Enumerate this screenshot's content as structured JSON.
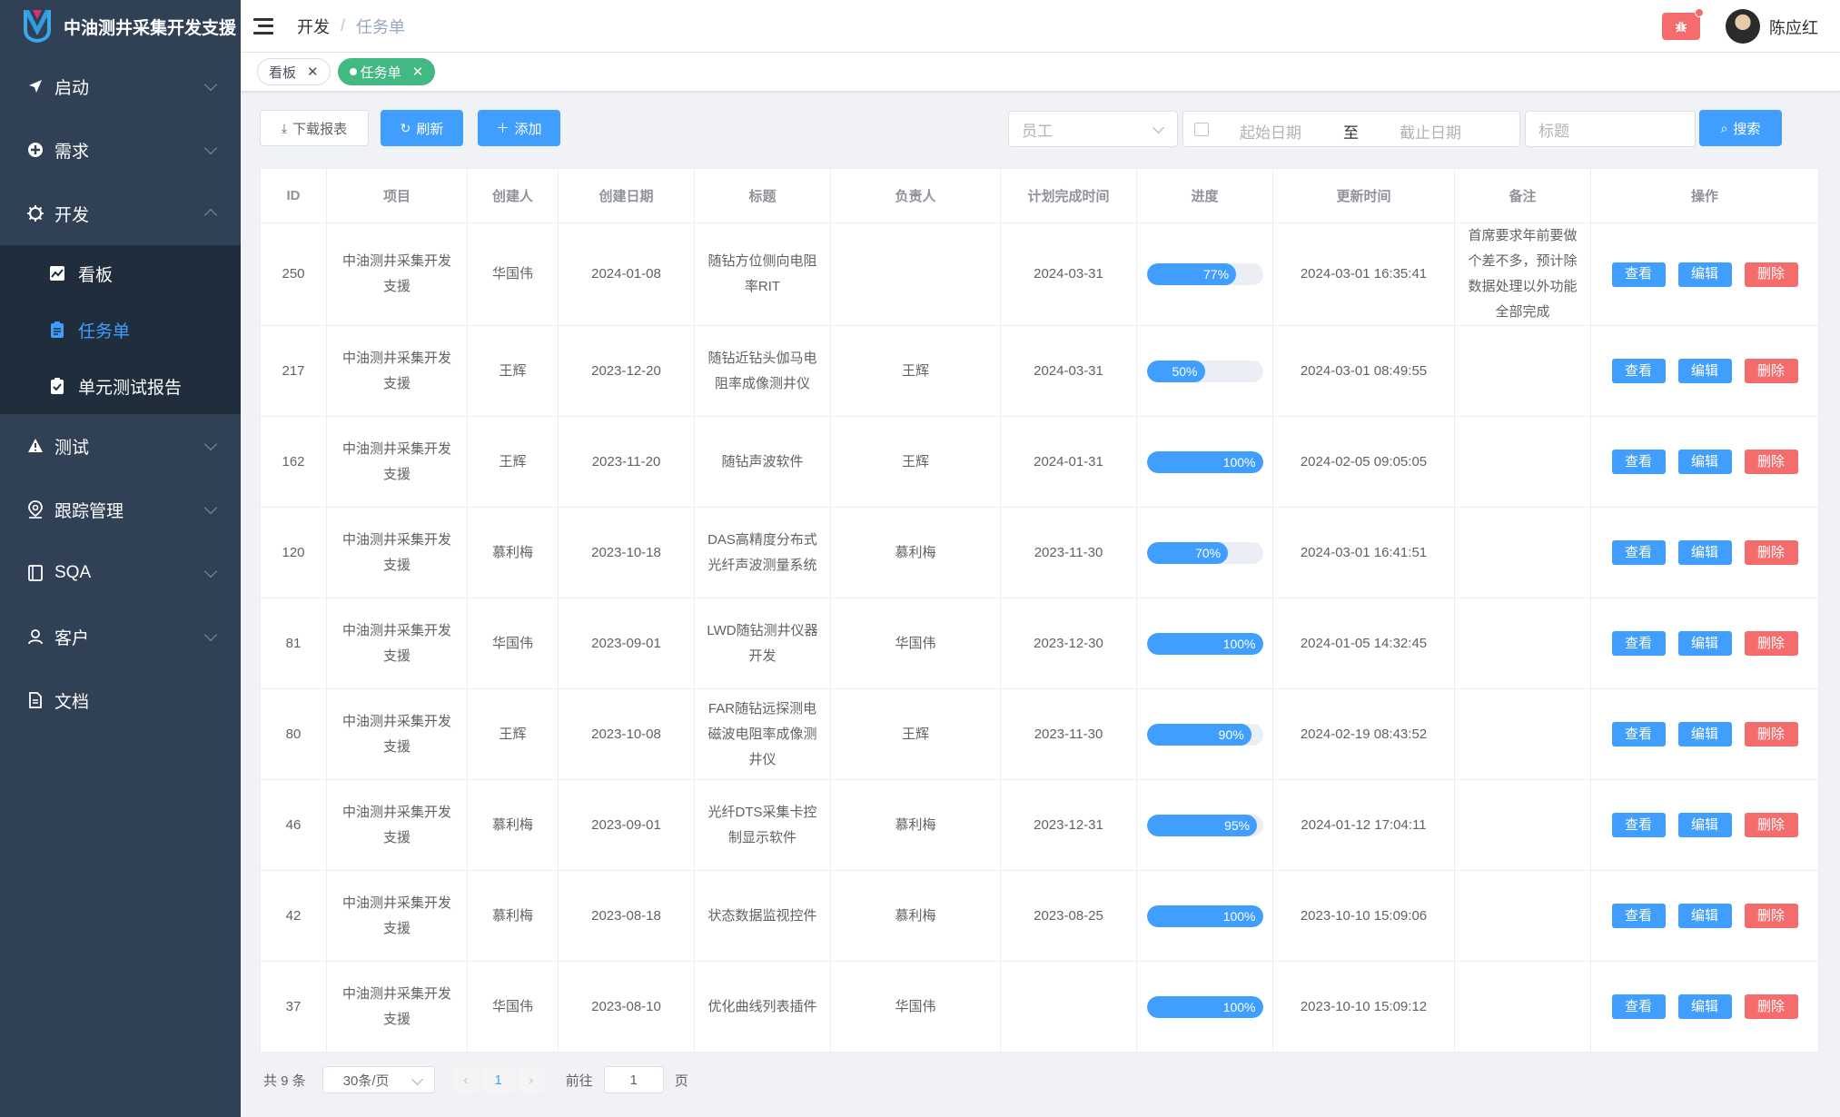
{
  "app": {
    "title": "中油测井采集开发支援"
  },
  "sidebar": {
    "items": [
      {
        "label": "启动",
        "icon": "send-icon"
      },
      {
        "label": "需求",
        "icon": "plus-circle-icon"
      },
      {
        "label": "开发",
        "icon": "gear-icon",
        "expanded": true,
        "children": [
          {
            "label": "看板",
            "icon": "chart-icon"
          },
          {
            "label": "任务单",
            "icon": "clipboard-icon",
            "active": true
          },
          {
            "label": "单元测试报告",
            "icon": "checklist-icon"
          }
        ]
      },
      {
        "label": "测试",
        "icon": "warning-icon"
      },
      {
        "label": "跟踪管理",
        "icon": "location-icon"
      },
      {
        "label": "SQA",
        "icon": "book-icon"
      },
      {
        "label": "客户",
        "icon": "user-icon"
      },
      {
        "label": "文档",
        "icon": "document-icon"
      }
    ]
  },
  "header": {
    "breadcrumb": [
      "开发",
      "任务单"
    ],
    "breadcrumb_sep": "/",
    "user_name": "陈应红"
  },
  "tags": [
    {
      "label": "看板",
      "active": false
    },
    {
      "label": "任务单",
      "active": true
    }
  ],
  "toolbar": {
    "download_label": "下载报表",
    "refresh_label": "刷新",
    "add_label": "添加",
    "employee_placeholder": "员工",
    "start_date_placeholder": "起始日期",
    "date_sep": "至",
    "end_date_placeholder": "截止日期",
    "title_placeholder": "标题",
    "search_label": "搜索"
  },
  "table": {
    "columns": [
      "ID",
      "项目",
      "创建人",
      "创建日期",
      "标题",
      "负责人",
      "计划完成时间",
      "进度",
      "更新时间",
      "备注",
      "操作"
    ],
    "actions": {
      "view": "查看",
      "edit": "编辑",
      "delete": "删除"
    },
    "rows": [
      {
        "id": "250",
        "project": "中油测井采集开发支援",
        "creator": "华国伟",
        "created": "2024-01-08",
        "title": "随钻方位侧向电阻率RIT",
        "owner": "",
        "plan": "2024-03-31",
        "progress": 77,
        "progress_label": "77%",
        "updated": "2024-03-01 16:35:41",
        "note": "首席要求年前要做个差不多，预计除数据处理以外功能全部完成"
      },
      {
        "id": "217",
        "project": "中油测井采集开发支援",
        "creator": "王辉",
        "created": "2023-12-20",
        "title": "随钻近钻头伽马电阻率成像测井仪",
        "owner": "王辉",
        "plan": "2024-03-31",
        "progress": 50,
        "progress_label": "50%",
        "updated": "2024-03-01 08:49:55",
        "note": ""
      },
      {
        "id": "162",
        "project": "中油测井采集开发支援",
        "creator": "王辉",
        "created": "2023-11-20",
        "title": "随钻声波软件",
        "owner": "王辉",
        "plan": "2024-01-31",
        "progress": 100,
        "progress_label": "100%",
        "updated": "2024-02-05 09:05:05",
        "note": ""
      },
      {
        "id": "120",
        "project": "中油测井采集开发支援",
        "creator": "慕利梅",
        "created": "2023-10-18",
        "title": "DAS高精度分布式光纤声波测量系统",
        "owner": "慕利梅",
        "plan": "2023-11-30",
        "progress": 70,
        "progress_label": "70%",
        "updated": "2024-03-01 16:41:51",
        "note": ""
      },
      {
        "id": "81",
        "project": "中油测井采集开发支援",
        "creator": "华国伟",
        "created": "2023-09-01",
        "title": "LWD随钻测井仪器开发",
        "owner": "华国伟",
        "plan": "2023-12-30",
        "progress": 100,
        "progress_label": "100%",
        "updated": "2024-01-05 14:32:45",
        "note": ""
      },
      {
        "id": "80",
        "project": "中油测井采集开发支援",
        "creator": "王辉",
        "created": "2023-10-08",
        "title": "FAR随钻远探测电磁波电阻率成像测井仪",
        "owner": "王辉",
        "plan": "2023-11-30",
        "progress": 90,
        "progress_label": "90%",
        "updated": "2024-02-19 08:43:52",
        "note": ""
      },
      {
        "id": "46",
        "project": "中油测井采集开发支援",
        "creator": "慕利梅",
        "created": "2023-09-01",
        "title": "光纤DTS采集卡控制显示软件",
        "owner": "慕利梅",
        "plan": "2023-12-31",
        "progress": 95,
        "progress_label": "95%",
        "updated": "2024-01-12 17:04:11",
        "note": ""
      },
      {
        "id": "42",
        "project": "中油测井采集开发支援",
        "creator": "慕利梅",
        "created": "2023-08-18",
        "title": "状态数据监视控件",
        "owner": "慕利梅",
        "plan": "2023-08-25",
        "progress": 100,
        "progress_label": "100%",
        "updated": "2023-10-10 15:09:06",
        "note": ""
      },
      {
        "id": "37",
        "project": "中油测井采集开发支援",
        "creator": "华国伟",
        "created": "2023-08-10",
        "title": "优化曲线列表插件",
        "owner": "华国伟",
        "plan": "",
        "progress": 100,
        "progress_label": "100%",
        "updated": "2023-10-10 15:09:12",
        "note": ""
      }
    ]
  },
  "pagination": {
    "total_label": "共 9 条",
    "page_size": "30条/页",
    "prev": "‹",
    "current_page": "1",
    "next": "›",
    "goto_label": "前往",
    "goto_value": "1",
    "page_suffix": "页"
  },
  "colors": {
    "sidebar_bg": "#304156",
    "submenu_bg": "#1f2d3d",
    "primary": "#409eff",
    "danger": "#f56c6c",
    "tag_active": "#42b983"
  }
}
